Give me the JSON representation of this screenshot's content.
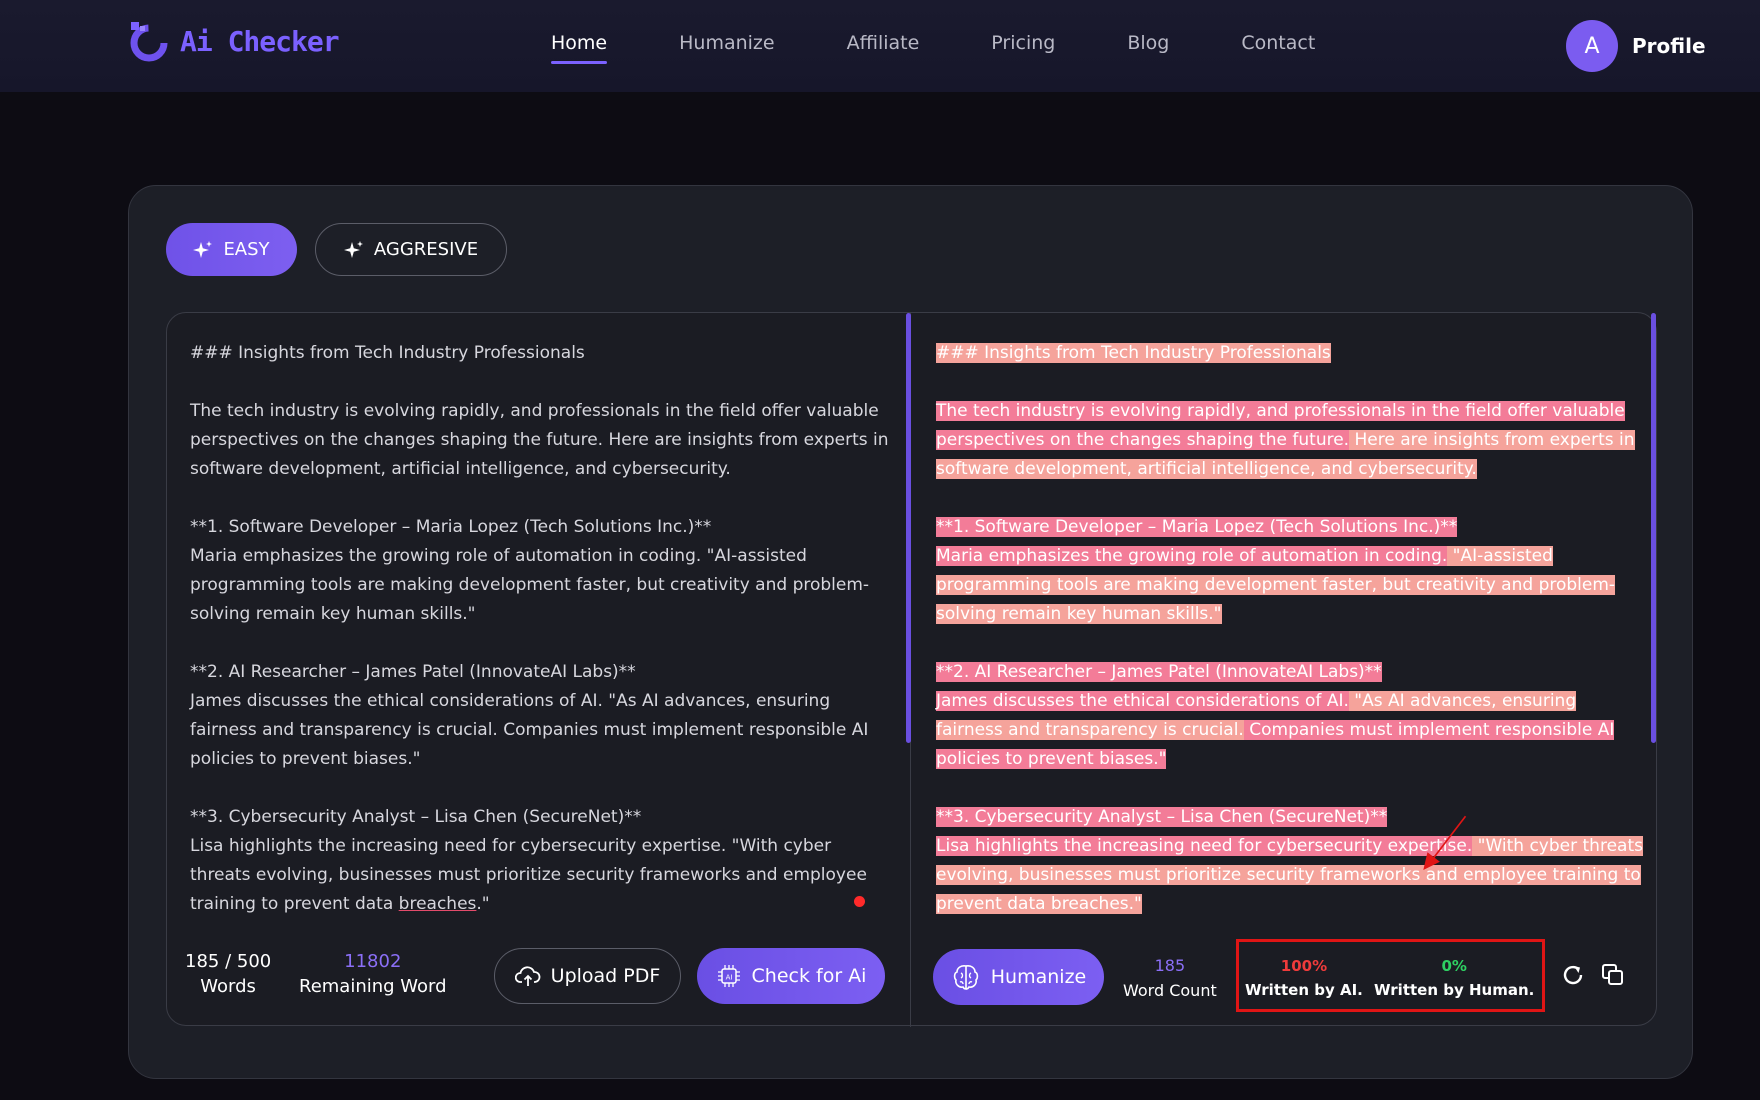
{
  "nav": {
    "logo_text": "Ai Checker",
    "items": [
      {
        "label": "Home",
        "active": true
      },
      {
        "label": "Humanize",
        "active": false
      },
      {
        "label": "Affiliate",
        "active": false
      },
      {
        "label": "Pricing",
        "active": false
      },
      {
        "label": "Blog",
        "active": false
      },
      {
        "label": "Contact",
        "active": false
      }
    ],
    "profile_initial": "A",
    "profile_label": "Profile"
  },
  "modes": {
    "easy": "EASY",
    "aggressive": "AGGRESIVE",
    "selected": "EASY"
  },
  "input_text": {
    "heading": "### Insights from Tech Industry Professionals",
    "intro": "The tech industry is evolving rapidly, and professionals in the field offer valuable perspectives on the changes shaping the future. Here are insights from experts in software development, artificial intelligence, and cybersecurity.",
    "s1_title": "**1. Software Developer – Maria Lopez (Tech Solutions Inc.)**",
    "s1_body": "Maria emphasizes the growing role of automation in coding. \"AI-assisted programming tools are making development faster, but creativity and problem-solving remain key human skills.\"",
    "s2_title": "**2. AI Researcher – James Patel (InnovateAI Labs)**",
    "s2_body": "James discusses the ethical considerations of AI. \"As AI advances, ensuring fairness and transparency is crucial. Companies must implement responsible AI policies to prevent biases.\"",
    "s3_title": "**3. Cybersecurity Analyst – Lisa Chen (SecureNet)**",
    "s3_body_a": "Lisa highlights the increasing need for cybersecurity expertise. \"With cyber threats evolving, businesses must prioritize security frameworks and employee training to prevent data ",
    "s3_body_b": "breaches",
    "s3_body_c": ".\""
  },
  "output_text": {
    "heading": "### Insights from Tech Industry Professionals",
    "intro_a": "The tech industry is evolving rapidly, and professionals in the field offer valuable perspectives on the changes shaping the future.",
    "intro_b": " Here are insights from experts in software development, artificial intelligence, and cybersecurity.",
    "s1_title": "**1. Software Developer – Maria Lopez (Tech Solutions Inc.)**",
    "s1_a": "Maria emphasizes the growing role of automation in coding.",
    "s1_b": " \"AI-assisted programming tools are making development faster, but creativity and problem-solving remain key human skills.\"",
    "s2_title": "**2. AI Researcher – James Patel (InnovateAI Labs)**",
    "s2_a": "James discusses the ethical considerations of AI.",
    "s2_b": " \"As AI advances, ensuring fairness and transparency is crucial.",
    "s2_c": " Companies must implement responsible AI policies to prevent biases.\"",
    "s3_title": "**3. Cybersecurity Analyst – Lisa Chen (SecureNet)**",
    "s3_a": "Lisa highlights the increasing need for cybersecurity expertise.",
    "s3_b": " \"With cyber threats evolving, businesses must prioritize security frameworks and employee training to prevent data breaches.\""
  },
  "left_footer": {
    "word_count": "185 / 500",
    "word_count_label": "Words",
    "remaining": "11802",
    "remaining_label": "Remaining Word",
    "upload_label": "Upload PDF",
    "check_label": "Check for Ai"
  },
  "right_footer": {
    "humanize_label": "Humanize",
    "word_count": "185",
    "word_count_label": "Word Count",
    "ai_percent": "100%",
    "ai_label": "Written by AI.",
    "human_percent": "0%",
    "human_label": "Written by Human."
  },
  "colors": {
    "accent": "#7b61ff",
    "ai_highlight": "#f37c98",
    "human_highlight": "#f5a39b",
    "ai_percent": "#ef3b3b",
    "human_percent": "#2ecf62",
    "annotation": "#e01515"
  },
  "icons": [
    "logo-icon",
    "sparkle-icon",
    "upload-cloud-icon",
    "ai-chip-icon",
    "brain-icon",
    "refresh-icon",
    "copy-icon",
    "annotation-arrow"
  ]
}
